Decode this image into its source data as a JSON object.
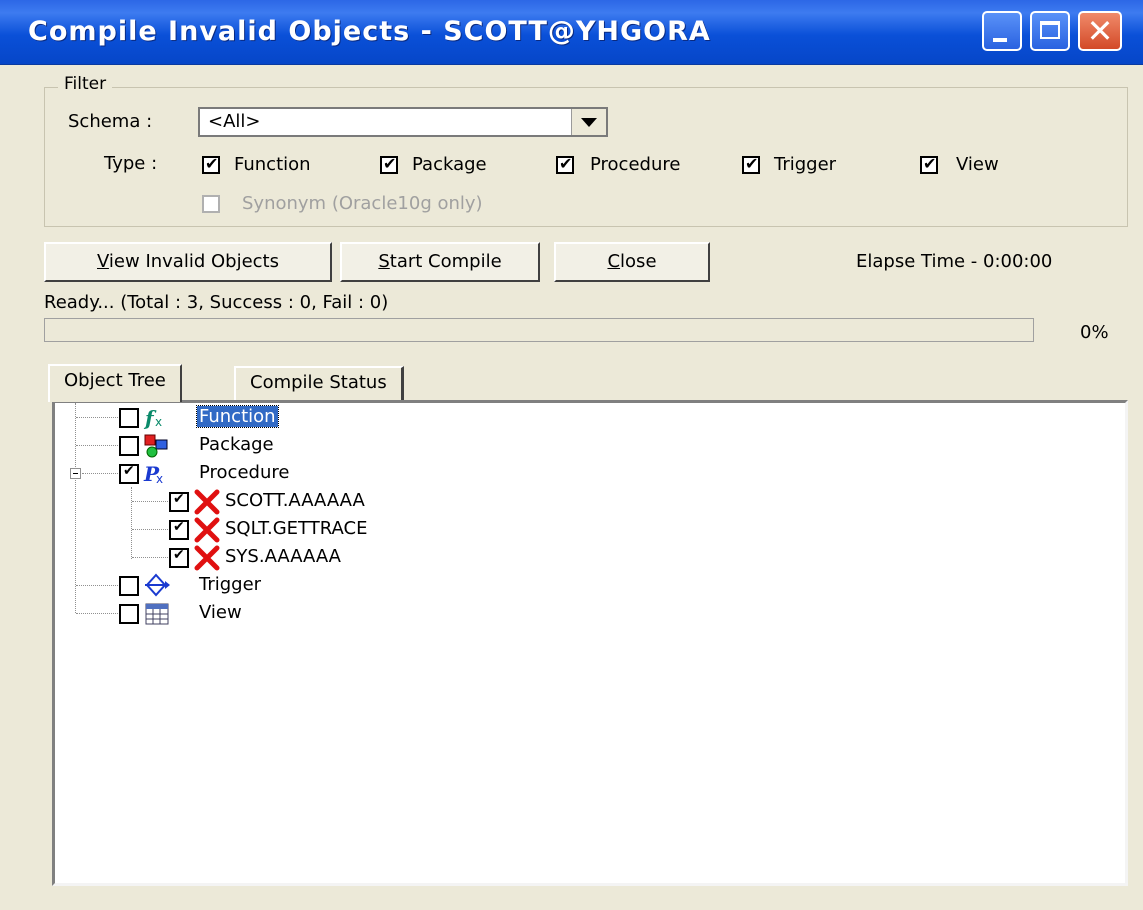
{
  "window": {
    "title": "Compile Invalid Objects - SCOTT@YHGORA",
    "controls": [
      "minimize-icon",
      "maximize-icon",
      "close-icon"
    ],
    "title_color": "#0a50d8"
  },
  "filter": {
    "legend": "Filter",
    "schema_label": "Schema :",
    "schema_value": "<All>",
    "type_label": "Type :",
    "types": [
      {
        "label": "Function",
        "checked": true
      },
      {
        "label": "Package",
        "checked": true
      },
      {
        "label": "Procedure",
        "checked": true
      },
      {
        "label": "Trigger",
        "checked": true
      },
      {
        "label": "View",
        "checked": true
      }
    ],
    "synonym": {
      "label": "Synonym (Oracle10g only)",
      "checked": false,
      "disabled": true
    }
  },
  "buttons": {
    "view_invalid_prefix": "V",
    "view_invalid_rest": "iew Invalid Objects",
    "start_compile_prefix": "S",
    "start_compile_rest": "tart Compile",
    "close_prefix": "C",
    "close_rest": "lose"
  },
  "elapsed": "Elapse Time - 0:00:00",
  "status": "Ready... (Total : 3, Success : 0, Fail : 0)",
  "progress": {
    "percent_label": "0%",
    "value": 0
  },
  "tabs": [
    {
      "label": "Object Tree",
      "active": true
    },
    {
      "label": "Compile Status",
      "active": false
    }
  ],
  "tree": {
    "nodes": [
      {
        "label": "Function",
        "checked": false,
        "icon": "function-icon",
        "selected": true
      },
      {
        "label": "Package",
        "checked": false,
        "icon": "package-icon"
      },
      {
        "label": "Procedure",
        "checked": true,
        "icon": "procedure-icon",
        "expanded": true,
        "children": [
          {
            "label": "SCOTT.AAAAAA",
            "checked": true,
            "icon": "invalid-icon"
          },
          {
            "label": "SQLT.GETTRACE",
            "checked": true,
            "icon": "invalid-icon"
          },
          {
            "label": "SYS.AAAAAA",
            "checked": true,
            "icon": "invalid-icon"
          }
        ]
      },
      {
        "label": "Trigger",
        "checked": false,
        "icon": "trigger-icon"
      },
      {
        "label": "View",
        "checked": false,
        "icon": "view-icon"
      }
    ]
  }
}
